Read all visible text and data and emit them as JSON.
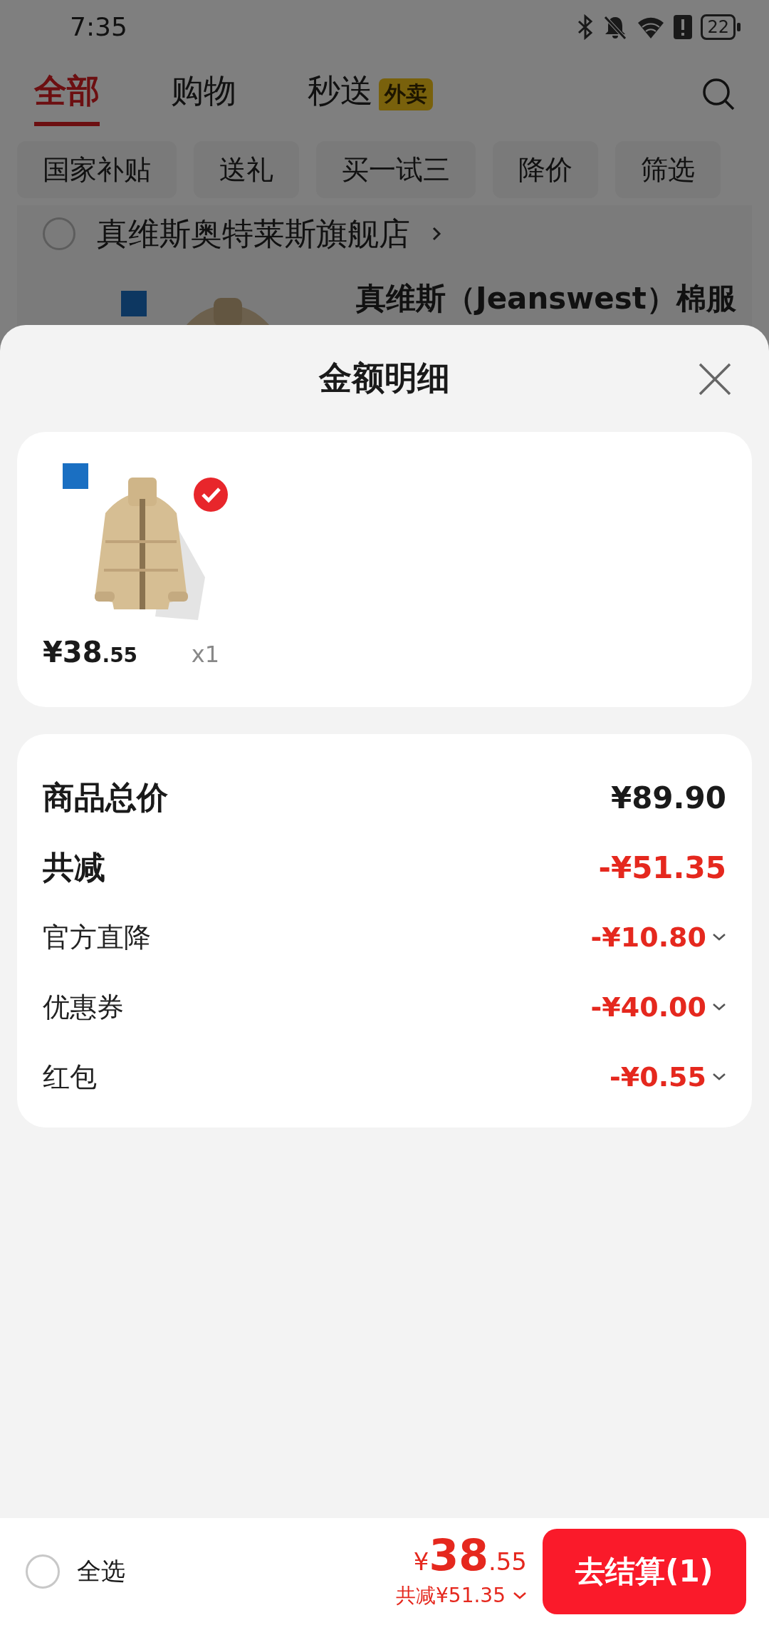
{
  "status_bar": {
    "time": "7:35",
    "battery": "22"
  },
  "tabs": [
    {
      "label": "全部",
      "selected": true
    },
    {
      "label": "购物",
      "selected": false
    },
    {
      "label": "秒送",
      "selected": false,
      "badge": "外卖"
    }
  ],
  "filters": [
    "国家补贴",
    "送礼",
    "买一试三",
    "降价",
    "筛选"
  ],
  "store": {
    "name": "真维斯奥特莱斯旗舰店",
    "checked": false,
    "product_title": "真维斯（Jeanswest）棉服"
  },
  "sheet": {
    "title": "金额明细",
    "items": [
      {
        "kind": "picture",
        "price": "¥38",
        "price_cents": ".55",
        "quantity": "x1",
        "selected": true
      }
    ],
    "summary": [
      {
        "kind": "heading",
        "label": "商品总价",
        "amount": "¥89.90",
        "negative": false
      },
      {
        "kind": "heading",
        "label": "共减",
        "amount": "-¥51.35",
        "negative": true
      },
      {
        "kind": "detail",
        "label": "官方直降",
        "amount": "-¥10.80",
        "negative": true
      },
      {
        "kind": "detail",
        "label": "优惠券",
        "amount": "-¥40.00",
        "negative": true
      },
      {
        "kind": "detail",
        "label": "红包",
        "amount": "-¥0.55",
        "negative": true
      }
    ]
  },
  "bottom_bar": {
    "select_all": {
      "label": "全选",
      "checked": false
    },
    "currency": "¥",
    "total": "38",
    "total_cents": ".55",
    "saved": "共减¥51.35",
    "checkout": "去结算(1)"
  }
}
